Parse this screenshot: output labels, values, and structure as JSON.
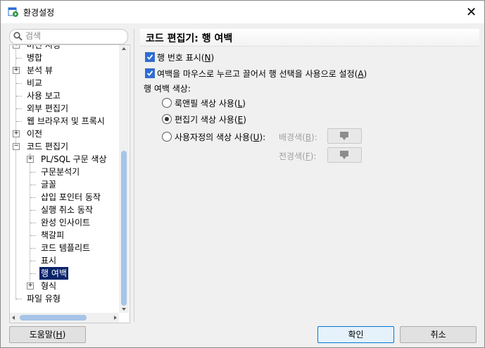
{
  "window": {
    "title": "환경설정",
    "close_glyph": "✕"
  },
  "search": {
    "placeholder": "검색"
  },
  "tree": {
    "items": [
      {
        "label": "버전 지정",
        "expander": "+"
      },
      {
        "label": "병합"
      },
      {
        "label": "분석 뷰",
        "expander": "+"
      },
      {
        "label": "비교"
      },
      {
        "label": "사용 보고"
      },
      {
        "label": "외부 편집기"
      },
      {
        "label": "웹 브라우저 및 프록시"
      },
      {
        "label": "이전",
        "expander": "+"
      },
      {
        "label": "코드 편집기",
        "expander": "−"
      },
      {
        "label": "PL/SQL 구문 색상",
        "expander": "+"
      },
      {
        "label": "구문분석기"
      },
      {
        "label": "글꼴"
      },
      {
        "label": "삽입 포인터 동작"
      },
      {
        "label": "실행 취소 동작"
      },
      {
        "label": "완성 인사이트"
      },
      {
        "label": "책갈피"
      },
      {
        "label": "코드 템플리트"
      },
      {
        "label": "표시"
      },
      {
        "label": "행 여백"
      },
      {
        "label": "형식",
        "expander": "+"
      },
      {
        "label": "파일 유형"
      }
    ]
  },
  "page": {
    "title": "코드 편집기: 행 여백",
    "show_line_numbers": {
      "text": "행 번호 표시(",
      "mnemonic": "N",
      "suffix": ")",
      "checked": true
    },
    "drag_select": {
      "text": "여백을 마우스로 누르고 끌어서 행 선택을 사용으로 설정(",
      "mnemonic": "A",
      "suffix": ")",
      "checked": true
    },
    "color_heading": "행 여백 색상:",
    "radio_laf": {
      "text": "룩앤필 색상 사용(",
      "mnemonic": "L",
      "suffix": ")",
      "selected": false
    },
    "radio_editor": {
      "text": "편집기 색상 사용(",
      "mnemonic": "E",
      "suffix": ")",
      "selected": true
    },
    "radio_custom": {
      "text": "사용자정의 색상 사용(",
      "mnemonic": "U",
      "suffix": "):",
      "selected": false
    },
    "background_label": {
      "text": "배경색(",
      "mnemonic": "B",
      "suffix": "):"
    },
    "foreground_label": {
      "text": "전경색(",
      "mnemonic": "F",
      "suffix": "):"
    }
  },
  "buttons": {
    "help": {
      "text": "도움말(",
      "mnemonic": "H",
      "suffix": ")"
    },
    "ok": "확인",
    "cancel": "취소"
  }
}
